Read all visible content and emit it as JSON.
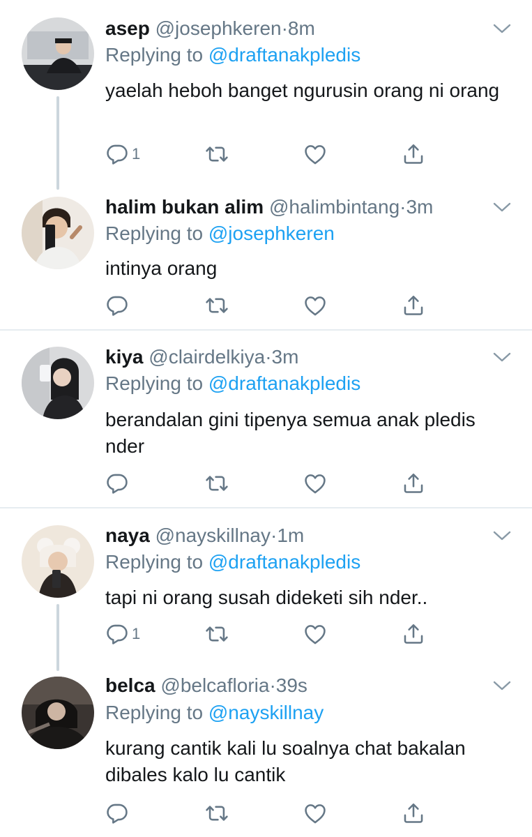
{
  "tweets": [
    {
      "name": "asep",
      "handle": "@josephkeren",
      "time": "8m",
      "replying_prefix": "Replying to",
      "replying_to": "@draftanakpledis",
      "text": "yaelah heboh banget ngurusin orang ni orang",
      "reply_count": "1"
    },
    {
      "name": "halim bukan alim",
      "handle": "@halimbintang",
      "time": "3m",
      "replying_prefix": "Replying to",
      "replying_to": "@josephkeren",
      "text": "intinya orang",
      "reply_count": ""
    },
    {
      "name": "kiya",
      "handle": "@clairdelkiya",
      "time": "3m",
      "replying_prefix": "Replying to",
      "replying_to": "@draftanakpledis",
      "text": "berandalan gini tipenya semua anak pledis nder",
      "reply_count": ""
    },
    {
      "name": "naya",
      "handle": "@nayskillnay",
      "time": "1m",
      "replying_prefix": "Replying to",
      "replying_to": "@draftanakpledis",
      "text": "tapi ni orang susah dideketi sih nder..",
      "reply_count": "1"
    },
    {
      "name": "belca",
      "handle": "@belcafloria",
      "time": "39s",
      "replying_prefix": "Replying to",
      "replying_to": "@nayskillnay",
      "text": "kurang cantik kali lu soalnya chat bakalan dibales kalo lu cantik",
      "reply_count": ""
    }
  ],
  "separator": "·",
  "icons": {
    "reply": "reply-icon",
    "retweet": "retweet-icon",
    "like": "heart-icon",
    "share": "share-icon",
    "menu": "chevron-down-icon"
  },
  "colors": {
    "link": "#1da1f2",
    "secondary": "#657786",
    "thread_line": "#ccd6dd",
    "divider": "#e6ecf0"
  }
}
